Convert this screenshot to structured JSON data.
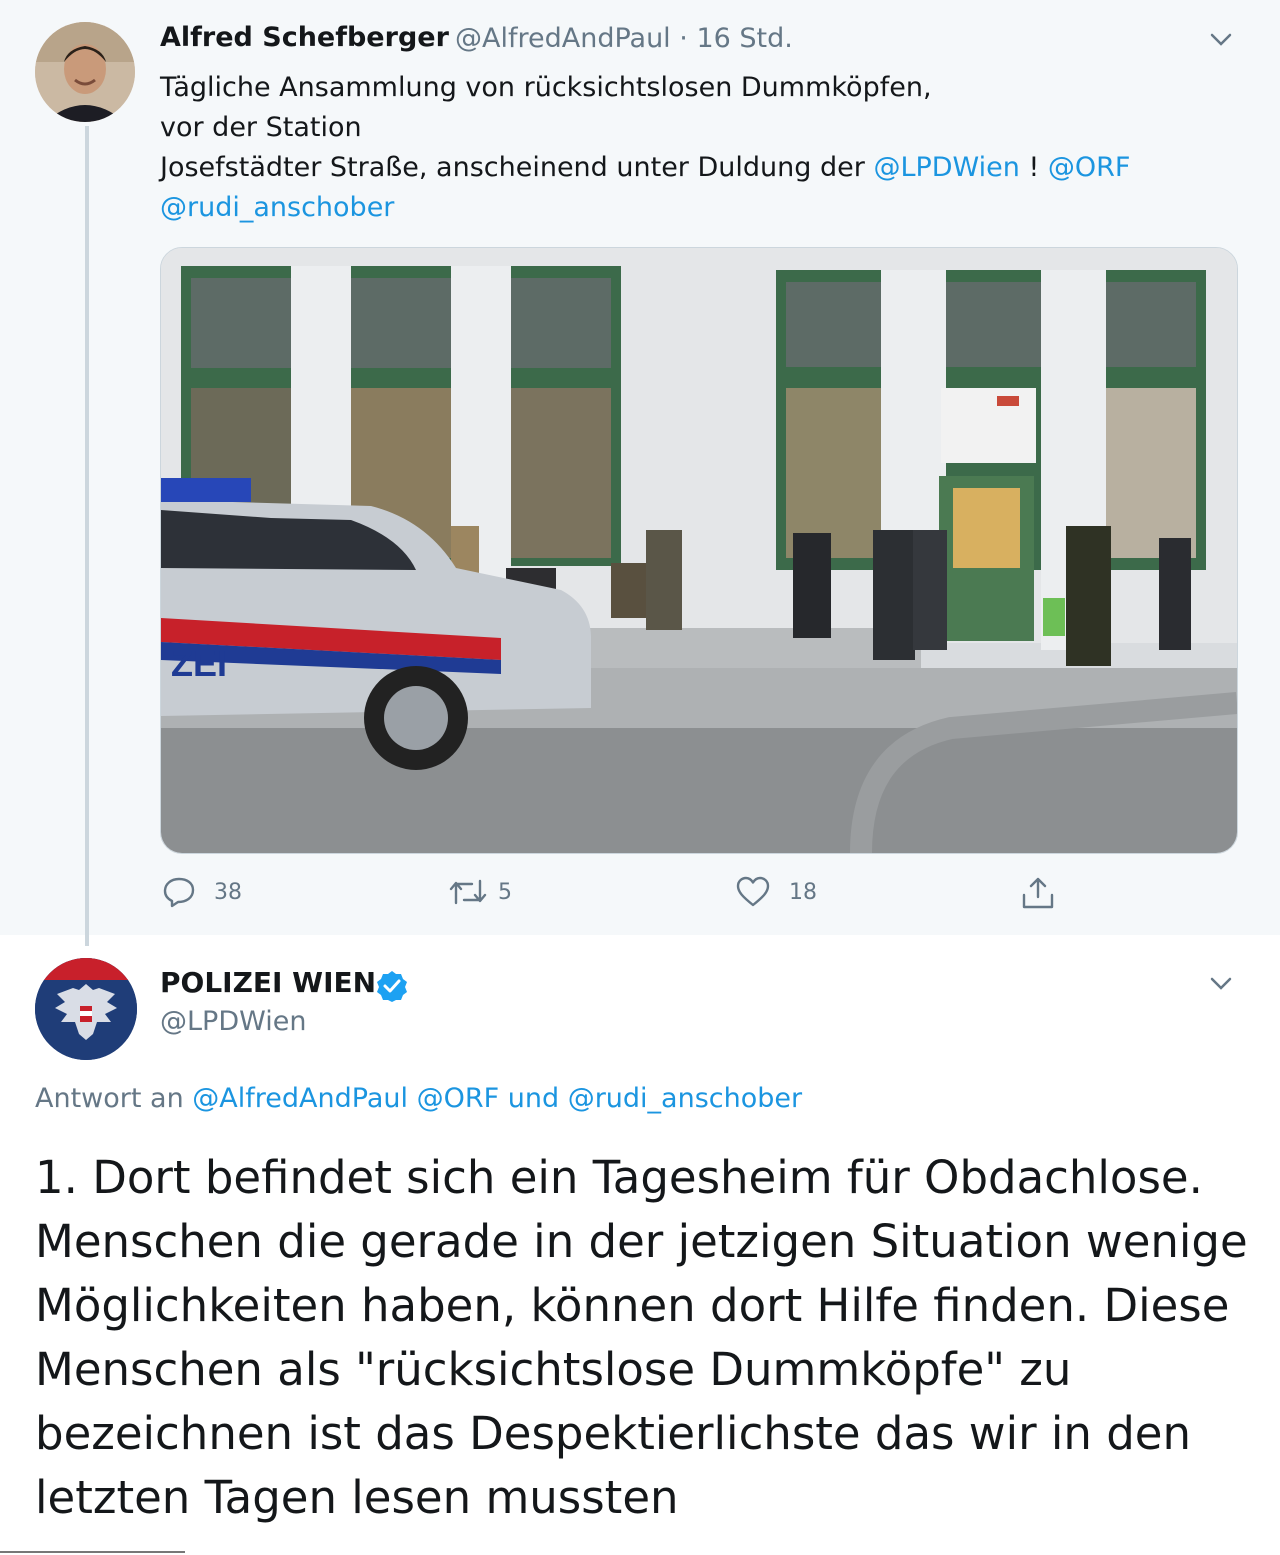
{
  "tweet1": {
    "author_name": "Alfred Schefberger",
    "author_handle": "@AlfredAndPaul",
    "time": "· 16 Std.",
    "text_line1": "Tägliche Ansammlung von rücksichtslosen Dummköpfen,",
    "text_line2": "vor der Station",
    "text_line3": "Josefstädter Straße, anscheinend unter Duldung der",
    "mention_lpd": "@LPDWien",
    "text_bang": " ! ",
    "mention_orf": "@ORF",
    "mention_rudi": "@rudi_anschober",
    "photo_caption_car": "ZEI",
    "replies": "38",
    "retweets": "5",
    "likes": "18"
  },
  "tweet2": {
    "author_name": "POLIZEI WIEN",
    "author_handle": "@LPDWien",
    "reply_prefix": "Antwort an",
    "reply_mention1": "@AlfredAndPaul",
    "reply_mention2": "@ORF",
    "reply_and": "und",
    "reply_mention3": "@rudi_anschober",
    "text_lines": [
      "1. Dort befindet sich ein Tagesheim für Obdachlose.",
      "Menschen die gerade in der jetzigen Situation wenige",
      "Möglichkeiten haben, können dort Hilfe finden. Diese",
      "Menschen als \"rücksichtslose Dummköpfe\" zu",
      "bezeichnen ist das Despektierlichste das wir in den",
      "letzten Tagen lesen mussten"
    ]
  },
  "icons": {
    "reply": "reply-icon",
    "retweet": "retweet-icon",
    "like": "heart-icon",
    "share": "share-icon",
    "menu": "chevron-down-icon",
    "verified": "verified-badge-icon"
  },
  "colors": {
    "link": "#1b95e0",
    "secondary_text": "#657786",
    "verified": "#1da1f2"
  }
}
